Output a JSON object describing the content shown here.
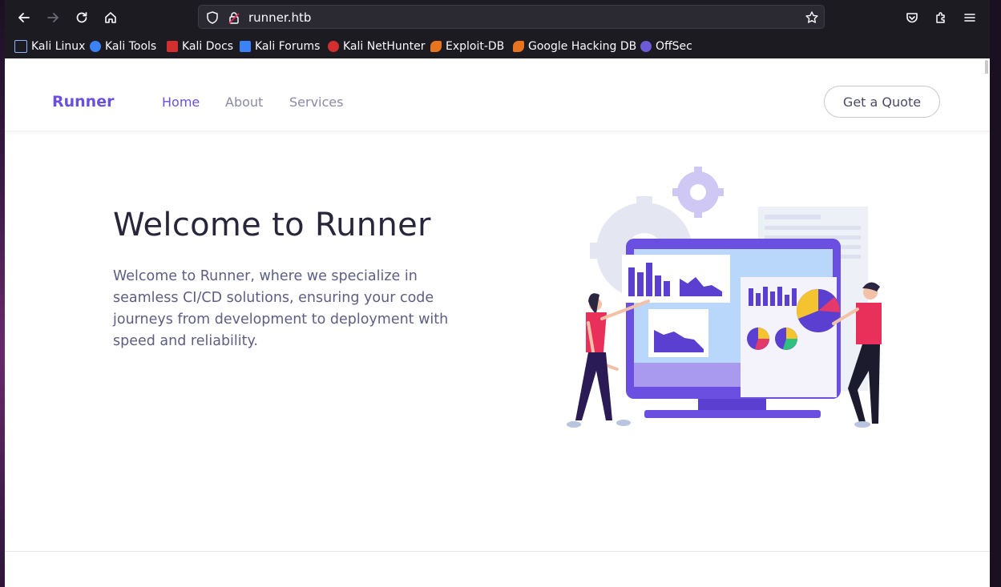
{
  "browser": {
    "url": "runner.htb",
    "bookmarks": [
      {
        "label": "Kali Linux",
        "color": "#3a6ea5"
      },
      {
        "label": "Kali Tools",
        "color": "#3b82f6"
      },
      {
        "label": "Kali Docs",
        "color": "#d32f2f"
      },
      {
        "label": "Kali Forums",
        "color": "#3b82f6"
      },
      {
        "label": "Kali NetHunter",
        "color": "#d32f2f"
      },
      {
        "label": "Exploit-DB",
        "color": "#e8741f"
      },
      {
        "label": "Google Hacking DB",
        "color": "#e8741f"
      },
      {
        "label": "OffSec",
        "color": "#6b5bd6"
      }
    ]
  },
  "nav": {
    "brand": "Runner",
    "links": [
      "Home",
      "About",
      "Services"
    ],
    "active": "Home",
    "cta": "Get a Quote"
  },
  "hero": {
    "title": "Welcome to Runner",
    "description": "Welcome to Runner, where we specialize in seamless CI/CD solutions, ensuring your code journeys from development to deployment with speed and reliability."
  },
  "colors": {
    "accent": "#6a4fe0",
    "chrome": "#1c1b22",
    "text_dark": "#27263a",
    "text_muted": "#5e5e84"
  }
}
